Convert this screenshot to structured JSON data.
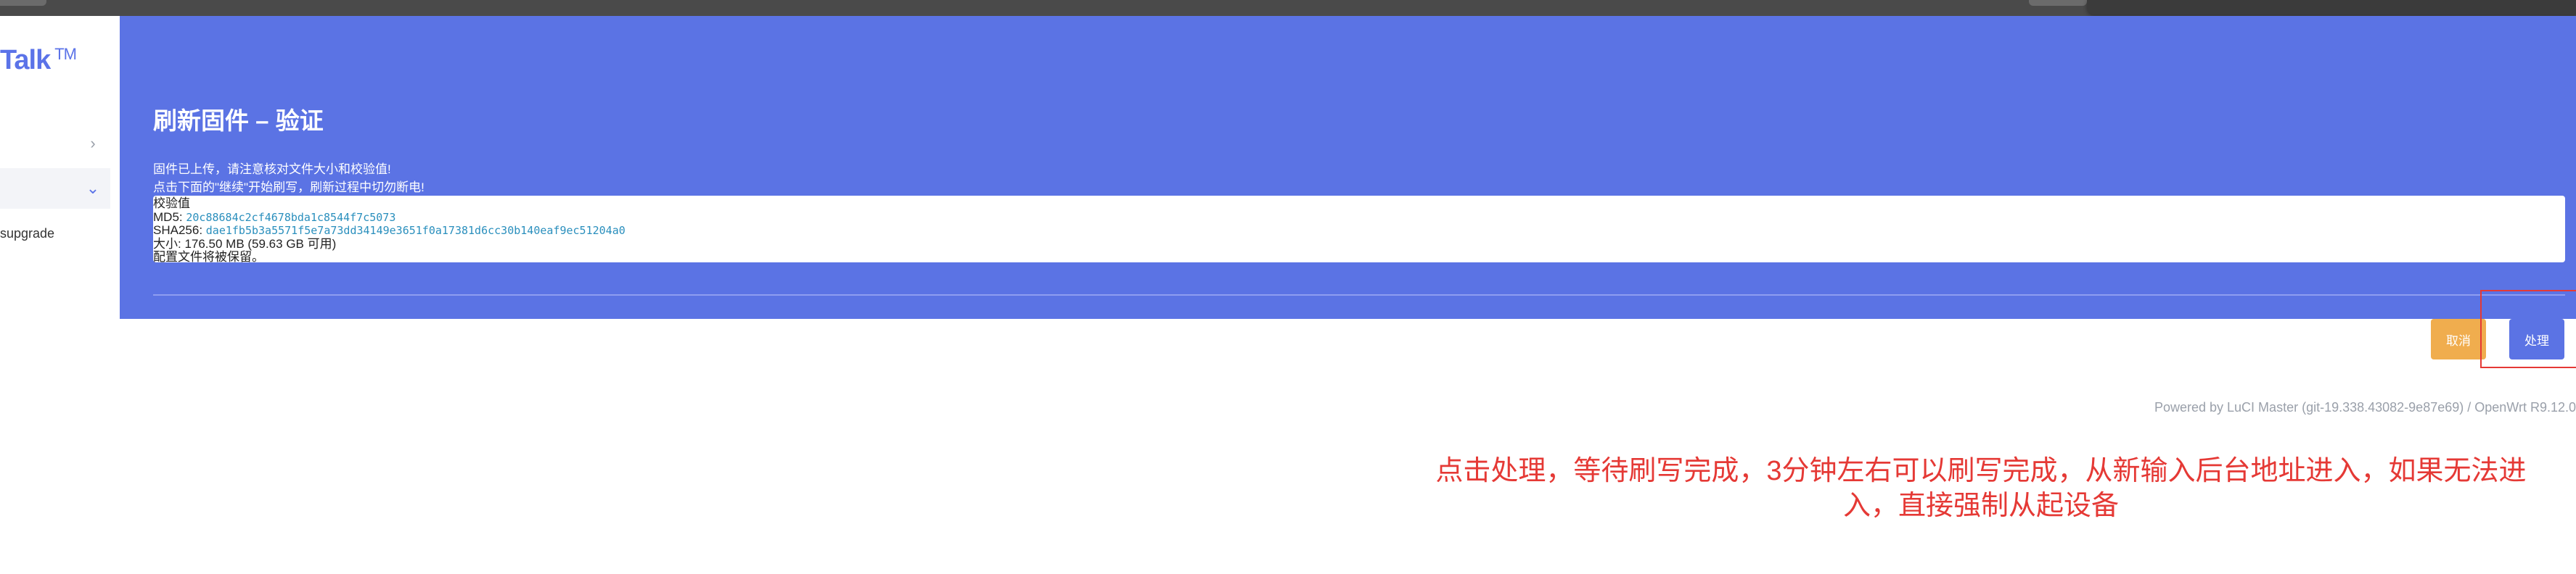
{
  "sidebar": {
    "logo_text": "Talk",
    "logo_tm": "TM",
    "items": [
      {
        "label": "",
        "chevron": "›"
      },
      {
        "label": "",
        "chevron": "⌄"
      },
      {
        "label": "supgrade"
      }
    ]
  },
  "page": {
    "title": "刷新固件 – 验证",
    "message_line1": "固件已上传，请注意核对文件大小和校验值!",
    "message_line2": "点击下面的\"继续\"开始刷写，刷新过程中切勿断电!",
    "checksum_heading": "校验值",
    "md5_label": "MD5:",
    "md5_value": "20c88684c2cf4678bda1c8544f7c5073",
    "sha256_label": "SHA256:",
    "sha256_value": "dae1fb5b3a5571f5e7a73dd34149e3651f0a17381d6cc30b140eaf9ec51204a0",
    "size_text": "大小: 176.50 MB (59.63 GB 可用)",
    "config_text": "配置文件将被保留。"
  },
  "actions": {
    "cancel_label": "取消",
    "process_label": "处理"
  },
  "footer": {
    "text": "Powered by LuCI Master (git-19.338.43082-9e87e69) / OpenWrt R9.12.0"
  },
  "annotation": {
    "text": "点击处理，等待刷写完成，3分钟左右可以刷写完成，从新输入后台地址进入，如果无法进入，直接强制从起设备"
  },
  "colors": {
    "primary": "#5b73e4",
    "cancel": "#f0ad4e",
    "annotation": "#e53935"
  }
}
